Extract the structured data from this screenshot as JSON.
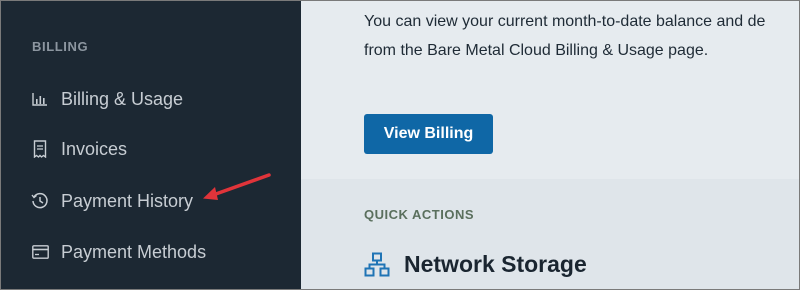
{
  "sidebar": {
    "section_label": "BILLING",
    "items": [
      {
        "label": "Billing & Usage",
        "icon": "bar-chart-icon"
      },
      {
        "label": "Invoices",
        "icon": "receipt-icon"
      },
      {
        "label": "Payment History",
        "icon": "clock-history-icon"
      },
      {
        "label": "Payment Methods",
        "icon": "credit-card-icon"
      }
    ]
  },
  "main": {
    "description_line1": "You can view your current month-to-date balance and de",
    "description_line2": "from the Bare Metal Cloud Billing & Usage page.",
    "view_billing_button": "View Billing",
    "quick_actions_label": "QUICK ACTIONS",
    "network_storage_title": "Network Storage",
    "network_storage_icon": "network-storage-icon"
  },
  "colors": {
    "sidebar_bg": "#1c2833",
    "main_bg": "#e6ebef",
    "button_bg": "#0f67a6",
    "annotation_arrow": "#e0343a",
    "icon_blue": "#1f74b5"
  }
}
